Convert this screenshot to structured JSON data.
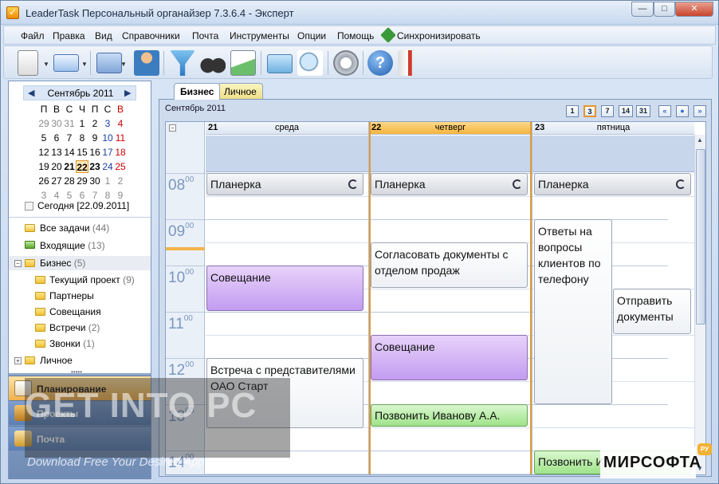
{
  "window": {
    "title": "LeaderTask Персональный органайзер 7.3.6.4 - Эксперт",
    "min": "—",
    "max": "□",
    "close": "✕"
  },
  "menu": [
    "Файл",
    "Правка",
    "Вид",
    "Справочники",
    "Почта",
    "Инструменты",
    "Опции",
    "Помощь",
    "Синхронизировать"
  ],
  "toolbar": {
    "icons": [
      "new-task-icon",
      "email-icon",
      "contacts-icon",
      "person-icon",
      "filter-icon",
      "binoculars-icon",
      "chart-icon",
      "print-icon",
      "print-preview-icon",
      "settings-icon",
      "help-icon",
      "megaphone-icon"
    ]
  },
  "mini_calendar": {
    "month": "Сентябрь 2011",
    "dow": [
      "П",
      "В",
      "С",
      "Ч",
      "П",
      "С",
      "В"
    ],
    "weeks": [
      [
        "29",
        "30",
        "31",
        "1",
        "2",
        "3",
        "4"
      ],
      [
        "5",
        "6",
        "7",
        "8",
        "9",
        "10",
        "11"
      ],
      [
        "12",
        "13",
        "14",
        "15",
        "16",
        "17",
        "18"
      ],
      [
        "19",
        "20",
        "21",
        "22",
        "23",
        "24",
        "25"
      ],
      [
        "26",
        "27",
        "28",
        "29",
        "30",
        "1",
        "2"
      ],
      [
        "3",
        "4",
        "5",
        "6",
        "7",
        "8",
        "9"
      ]
    ],
    "today_link": "Сегодня [22.09.2011]"
  },
  "tree": [
    {
      "label": "Все задачи",
      "count": "(44)"
    },
    {
      "label": "Входящие",
      "count": "(13)"
    },
    {
      "label": "Бизнес",
      "count": "(5)"
    },
    {
      "label": "Текущий проект",
      "count": "(9)"
    },
    {
      "label": "Партнеры",
      "count": ""
    },
    {
      "label": "Совещания",
      "count": ""
    },
    {
      "label": "Встречи",
      "count": "(2)"
    },
    {
      "label": "Звонки",
      "count": "(1)"
    },
    {
      "label": "Личное",
      "count": ""
    }
  ],
  "nav": {
    "plan": "Планирование",
    "projects": "Проекты",
    "mail": "Почта"
  },
  "tabs": {
    "business": "Бизнес",
    "personal": "Личное"
  },
  "view": {
    "date_label": "Сентябрь 2011",
    "buttons": [
      "1",
      "3",
      "7",
      "14",
      "31"
    ]
  },
  "days": [
    {
      "num": "21",
      "name": "среда"
    },
    {
      "num": "22",
      "name": "четверг"
    },
    {
      "num": "23",
      "name": "пятница"
    }
  ],
  "hours": [
    "08",
    "09",
    "10",
    "11",
    "12",
    "13",
    "14"
  ],
  "minutes": "00",
  "events": {
    "wed": [
      "Планерка",
      "Совещание",
      "Встреча с представителями ОАО Старт"
    ],
    "thu": [
      "Планерка",
      "Согласовать документы с отделом продаж",
      "Совещание",
      "Позвонить Иванову А.А."
    ],
    "fri": [
      "Планерка",
      "Ответы на вопросы клиентов по телефону",
      "Отправить документы",
      "Позвонить И"
    ]
  },
  "watermark": {
    "big": "GET INTO PC",
    "small": "Download Free Your Desired App",
    "brand": "МИРСОФТА",
    "badge": "РУ"
  },
  "colors": {
    "today_header": "#f5b43e",
    "event_purple": "#c39cf0",
    "event_green": "#9fe38a"
  }
}
